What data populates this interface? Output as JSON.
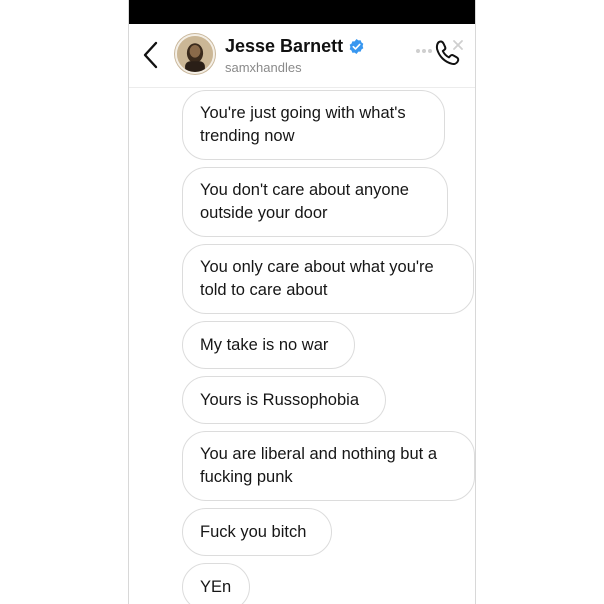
{
  "header": {
    "name": "Jesse Barnett",
    "handle": "samxhandles",
    "verified": true
  },
  "messages": [
    {
      "text": "You're just going with what's\ntrending now"
    },
    {
      "text": "You don't care about anyone\noutside your door"
    },
    {
      "text": "You only care about what you're\ntold to care about"
    },
    {
      "text": "My take is no war"
    },
    {
      "text": "Yours is Russophobia"
    },
    {
      "text": "You are liberal and nothing but a\nfucking punk"
    },
    {
      "text": "Fuck you bitch"
    },
    {
      "text": "YEn"
    }
  ],
  "colors": {
    "verified": "#3897f0",
    "bubble_border": "#dcdcdc",
    "status_bar": "#000000"
  }
}
